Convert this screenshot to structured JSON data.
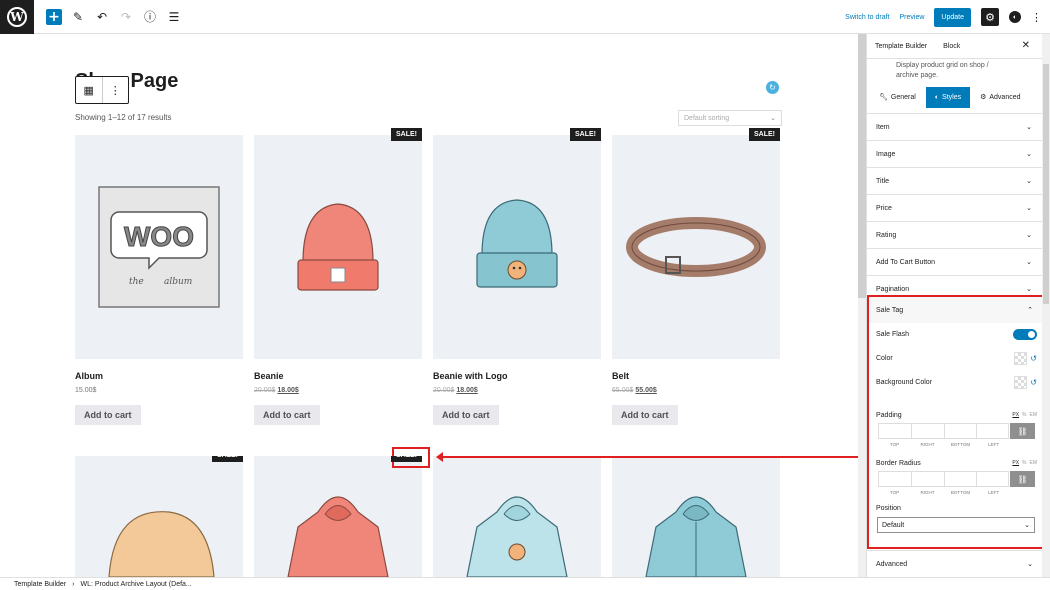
{
  "topbar": {
    "switch_to_draft": "Switch to draft",
    "preview": "Preview",
    "update": "Update"
  },
  "canvas": {
    "page_title": "Shop Page",
    "results": "Showing 1–12 of 17 results",
    "sorting": "Default sorting",
    "add_to_cart": "Add to cart",
    "sale_label": "SALE!",
    "products_row1": [
      {
        "name": "Album",
        "price": "15.00$",
        "old_price": "",
        "sale": false
      },
      {
        "name": "Beanie",
        "price": "18.00$",
        "old_price": "20.00$",
        "sale": true
      },
      {
        "name": "Beanie with Logo",
        "price": "18.00$",
        "old_price": "20.00$",
        "sale": true
      },
      {
        "name": "Belt",
        "price": "55.00$",
        "old_price": "65.00$",
        "sale": true
      }
    ]
  },
  "sidebar": {
    "tab_template": "Template Builder",
    "tab_block": "Block",
    "description": "Display product grid on shop / archive page.",
    "panel_tabs": {
      "general": "General",
      "styles": "Styles",
      "advanced": "Advanced"
    },
    "sections": [
      "Item",
      "Image",
      "Title",
      "Price",
      "Rating",
      "Add To Cart Button",
      "Pagination"
    ],
    "sale_tag": {
      "title": "Sale Tag",
      "sale_flash": "Sale Flash",
      "color": "Color",
      "background_color": "Background Color",
      "padding": "Padding",
      "border_radius": "Border Radius",
      "units": [
        "PX",
        "%",
        "EM"
      ],
      "dims": [
        "TOP",
        "RIGHT",
        "BOTTOM",
        "LEFT"
      ],
      "position": "Position",
      "position_value": "Default"
    },
    "advanced_section": "Advanced"
  },
  "footer": {
    "crumb1": "Template Builder",
    "crumb2": "WL: Product Archive Layout (Defa..."
  },
  "colors": {
    "accent": "#007cba",
    "highlight": "#e02020"
  }
}
